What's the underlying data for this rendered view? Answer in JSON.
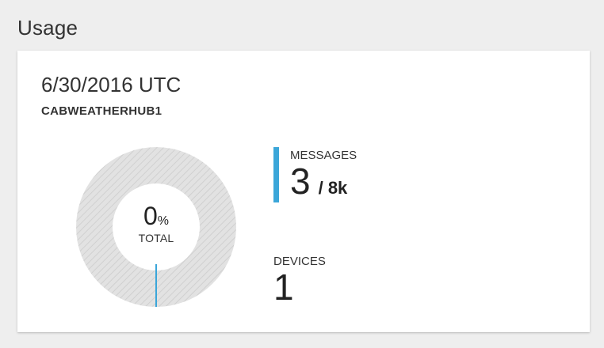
{
  "section": {
    "title": "Usage"
  },
  "card": {
    "date": "6/30/2016 UTC",
    "hub_name": "CABWEATHERHUB1",
    "usage": {
      "percent_value": "0",
      "percent_sign": "%",
      "label": "TOTAL",
      "fraction": 0.0
    },
    "messages": {
      "label": "MESSAGES",
      "value": "3",
      "limit": "/ 8k"
    },
    "devices": {
      "label": "DEVICES",
      "value": "1"
    }
  },
  "colors": {
    "accent": "#3ba6d9",
    "donut_track": "#e2e2e2",
    "donut_hatch": "#cfcfcf",
    "background": "#eeeeee",
    "card": "#ffffff"
  },
  "icons": {
    "donut": "usage-donut-chart"
  }
}
